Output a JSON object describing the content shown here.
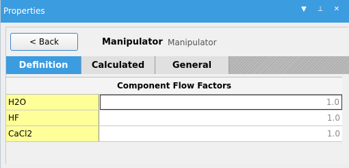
{
  "window": {
    "title": "Properties"
  },
  "icons": {
    "dropdown": "triangle-down-icon",
    "pin": "pin-icon",
    "close": "close-icon"
  },
  "header": {
    "back_label": "< Back",
    "object_name": "Manipulator",
    "object_type": "Manipulator"
  },
  "tabs": [
    {
      "label": "Definition",
      "active": true
    },
    {
      "label": "Calculated",
      "active": false
    },
    {
      "label": "General",
      "active": false
    }
  ],
  "table": {
    "title": "Component Flow Factors",
    "rows": [
      {
        "component": "H2O",
        "value": "1.0"
      },
      {
        "component": "HF",
        "value": "1.0"
      },
      {
        "component": "CaCl2",
        "value": "1.0"
      }
    ]
  },
  "colors": {
    "accent": "#3b9ce0",
    "label_bg": "#ffff99",
    "value_text": "#8a8a8a"
  }
}
